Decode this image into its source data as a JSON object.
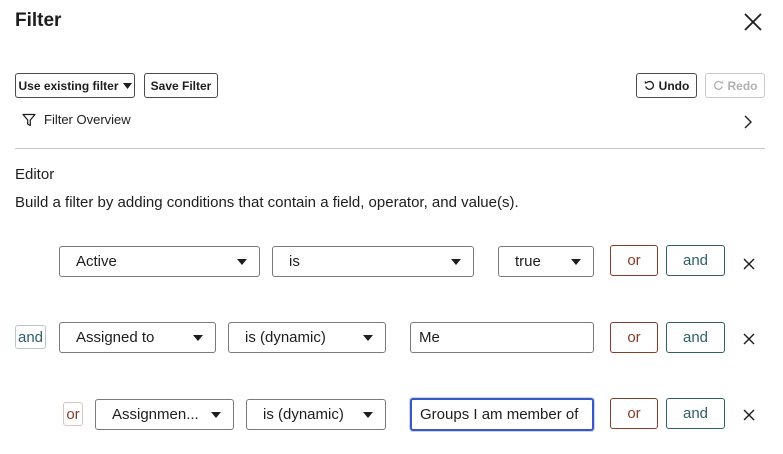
{
  "header": {
    "title": "Filter"
  },
  "toolbar": {
    "use_existing_label": "Use existing filter",
    "save_label": "Save Filter",
    "undo_label": "Undo",
    "redo_label": "Redo"
  },
  "overview": {
    "label": "Filter Overview"
  },
  "editor": {
    "heading": "Editor",
    "description": "Build a filter by adding conditions that contain a field, operator, and value(s).",
    "or_label": "or",
    "and_label": "and",
    "conditions": [
      {
        "join": "",
        "field": "Active",
        "operator": "is",
        "value": "true",
        "value_type": "select"
      },
      {
        "join": "and",
        "field": "Assigned to",
        "operator": "is (dynamic)",
        "value": "Me",
        "value_type": "text"
      },
      {
        "join": "or",
        "field": "Assignmen...",
        "operator": "is (dynamic)",
        "value": "Groups I am member of",
        "value_type": "text",
        "focused": true
      }
    ]
  },
  "icons": [
    "close-icon",
    "caret-down-icon",
    "undo-icon",
    "redo-icon",
    "filter-funnel-icon",
    "chevron-right-icon",
    "remove-x-icon"
  ],
  "colors": {
    "or_accent": "#8b3a2a",
    "and_accent": "#2e5f67",
    "focus": "#3a57c4"
  }
}
